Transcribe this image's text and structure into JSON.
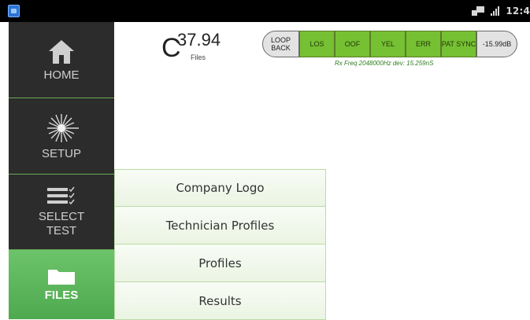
{
  "status_bar": {
    "time": "12:4",
    "icons": [
      "app-icon",
      "sync-icon",
      "signal-icon"
    ]
  },
  "sidebar": {
    "items": [
      {
        "label": "HOME",
        "icon": "home-icon"
      },
      {
        "label": "SETUP",
        "icon": "laser-burst-icon"
      },
      {
        "label_line1": "SELECT",
        "label_line2": "TEST",
        "icon": "checklist-icon"
      },
      {
        "label": "FILES",
        "icon": "folder-icon",
        "active": true
      }
    ]
  },
  "readout": {
    "prefix": "C",
    "value": "37.94",
    "unit": "Files"
  },
  "indicators": {
    "loopback": "LOOP BACK",
    "los": "LOS",
    "oof": "OOF",
    "yel": "YEL",
    "err": "ERR",
    "pat_sync": "PAT SYNC",
    "level": "-15.99dB",
    "rx_freq": "Rx Freq 2048000Hz dev: 15.259nS",
    "colors": {
      "alarm_ok": "#76c033",
      "neutral": "#e3e3e3"
    }
  },
  "files_menu": {
    "items": [
      "Company Logo",
      "Technician Profiles",
      "Profiles",
      "Results"
    ]
  },
  "theme": {
    "sidebar_bg": "#2c2c2c",
    "active_green": "#5cb85c"
  }
}
